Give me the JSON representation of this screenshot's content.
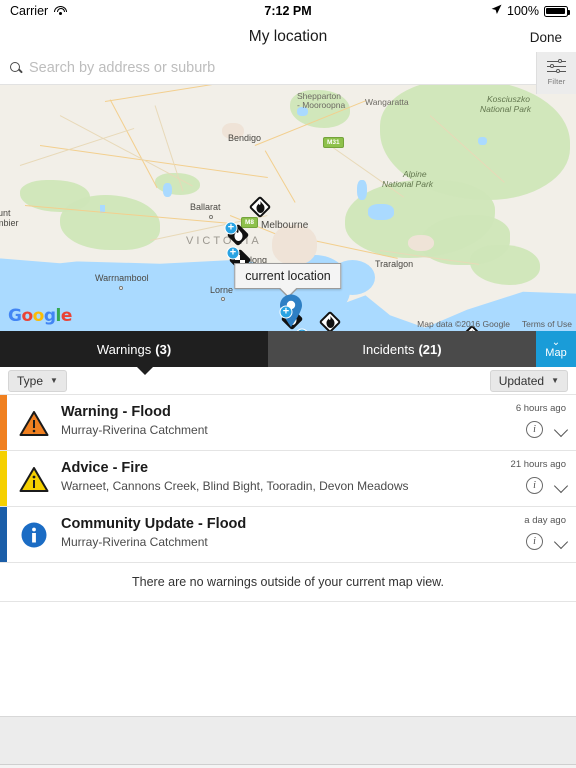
{
  "statusbar": {
    "carrier": "Carrier",
    "wifi_icon": "wifi-icon",
    "time": "7:12 PM",
    "location_icon": "location-arrow-icon",
    "battery_percent": "100%",
    "battery_icon": "battery-full-icon"
  },
  "navbar": {
    "title": "My location",
    "done_label": "Done"
  },
  "search": {
    "icon": "search-icon",
    "value": "",
    "placeholder": "Search by address or suburb",
    "filter_label": "Filter",
    "filter_icon": "sliders-icon"
  },
  "map": {
    "tooltip": "current location",
    "attribution_google": "Google",
    "attribution_data": "Map data ©2016 Google",
    "attribution_terms": "Terms of Use",
    "labels": [
      {
        "text": "VICTORIA",
        "type": "state"
      },
      {
        "text": "Shepparton",
        "type": "city"
      },
      {
        "text": "- Mooroopna",
        "type": "city"
      },
      {
        "text": "Wangaratta",
        "type": "city"
      },
      {
        "text": "Kosciuszko",
        "type": "park"
      },
      {
        "text": "National Park",
        "type": "park"
      },
      {
        "text": "Alpine",
        "type": "park"
      },
      {
        "text": "National Park",
        "type": "park"
      },
      {
        "text": "Bendigo",
        "type": "city"
      },
      {
        "text": "Ballarat",
        "type": "city"
      },
      {
        "text": "Melbourne",
        "type": "city"
      },
      {
        "text": "Geelong",
        "type": "city"
      },
      {
        "text": "Warrnambool",
        "type": "city"
      },
      {
        "text": "Lorne",
        "type": "city"
      },
      {
        "text": "Traralgon",
        "type": "city"
      },
      {
        "text": "unt",
        "type": "city"
      },
      {
        "text": "mbier",
        "type": "city"
      },
      {
        "text": "M31",
        "type": "shield"
      },
      {
        "text": "M8",
        "type": "shield"
      }
    ],
    "markers": [
      {
        "name": "fire-marker",
        "glyph": "fire",
        "style": "outline",
        "badge": false
      },
      {
        "name": "fire-marker",
        "glyph": "fire",
        "style": "filled",
        "badge": true
      },
      {
        "name": "fire-marker",
        "glyph": "fire",
        "style": "filled",
        "badge": true
      },
      {
        "name": "fire-marker",
        "glyph": "fire",
        "style": "filled",
        "badge": true
      },
      {
        "name": "fire-marker",
        "glyph": "fire",
        "style": "outline",
        "badge": false
      },
      {
        "name": "incident-marker",
        "glyph": "burnt-area",
        "style": "filled",
        "badge": true
      },
      {
        "name": "fire-marker",
        "glyph": "fire",
        "style": "outline",
        "badge": false
      },
      {
        "name": "unknown-marker",
        "glyph": "?",
        "style": "outline",
        "badge": false
      },
      {
        "name": "advice-warning-marker",
        "glyph": "triangle-warning",
        "style": "yellow",
        "badge": true
      }
    ]
  },
  "tabs": {
    "warnings_label": "Warnings",
    "warnings_count": "(3)",
    "incidents_label": "Incidents",
    "incidents_count": "(21)",
    "map_toggle_label": "Map",
    "map_toggle_icon": "chevron-down-icon",
    "active": "warnings"
  },
  "filters": {
    "type_label": "Type",
    "sort_label": "Updated",
    "caret_icon": "caret-down-icon"
  },
  "list": {
    "empty_message": "There are no warnings outside of your current map view.",
    "info_icon": "info-circle-icon",
    "expand_icon": "chevron-down-icon",
    "rows": [
      {
        "title": "Warning - Flood",
        "subtitle": "Murray-Riverina Catchment",
        "time": "6 hours ago",
        "stripe_color": "#F08020",
        "icon": "warning-triangle-orange-icon"
      },
      {
        "title": "Advice - Fire",
        "subtitle": "Warneet, Cannons Creek, Blind Bight, Tooradin, Devon Meadows",
        "time": "21 hours ago",
        "stripe_color": "#F5D000",
        "icon": "advice-triangle-yellow-icon"
      },
      {
        "title": "Community Update - Flood",
        "subtitle": "Murray-Riverina Catchment",
        "time": "a day ago",
        "stripe_color": "#1B5EA8",
        "icon": "info-circle-blue-icon"
      }
    ]
  },
  "colors": {
    "accent_blue": "#1a9cd8",
    "tab_active": "#1f1f1f",
    "tab_inactive": "#4a4a4a",
    "warning_orange": "#F08020",
    "advice_yellow": "#F5D000",
    "community_blue": "#1B5EA8"
  }
}
